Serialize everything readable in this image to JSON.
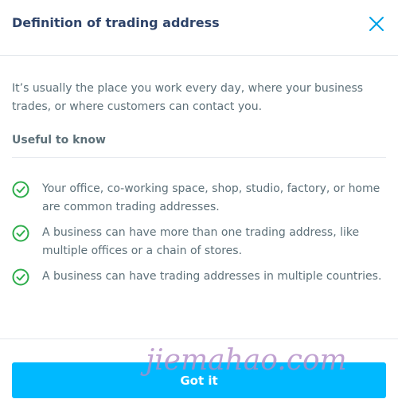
{
  "modal": {
    "title": "Definition of trading address",
    "close_icon": "close-icon"
  },
  "content": {
    "intro": "It’s usually the place you work every day, where your business trades, or where customers can contact you.",
    "section_title": "Useful to know",
    "items": [
      {
        "icon": "check-circle-icon",
        "text": "Your office, co-working space, shop, studio, factory, or home are common trading addresses."
      },
      {
        "icon": "check-circle-icon",
        "text": "A business can have more than one trading address, like multiple offices or a chain of stores."
      },
      {
        "icon": "check-circle-icon",
        "text": "A business can have trading addresses in multiple countries."
      }
    ]
  },
  "footer": {
    "button_label": "Got it"
  },
  "watermark": "jiemahao.com",
  "colors": {
    "accent": "#00b9ff",
    "check": "#2ead4b",
    "title": "#2e4369",
    "text": "#5d7079",
    "divider": "#e3e7ec"
  }
}
